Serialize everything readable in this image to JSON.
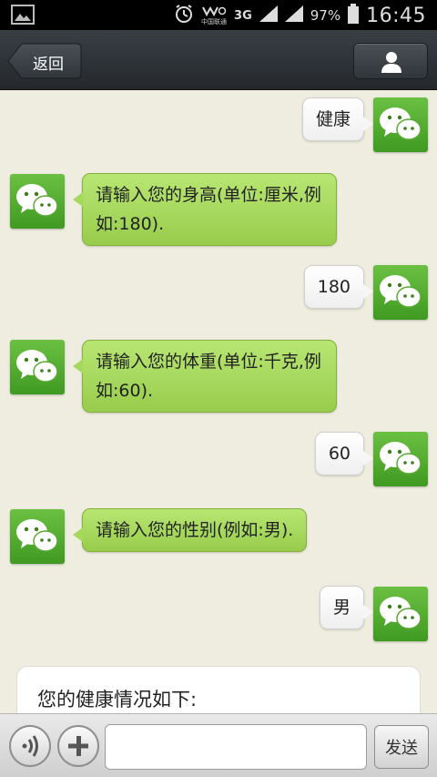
{
  "status_bar": {
    "carrier_line1": "中国联通",
    "network": "3G",
    "battery": "97%",
    "time": "16:45"
  },
  "nav": {
    "back_label": "返回",
    "contact_icon": "person-icon"
  },
  "messages": [
    {
      "side": "out",
      "text": "健康"
    },
    {
      "side": "in",
      "text": "请输入您的身高(单位:厘米,例如:180)."
    },
    {
      "side": "out",
      "text": "180"
    },
    {
      "side": "in",
      "text": "请输入您的体重(单位:千克,例如:60)."
    },
    {
      "side": "out",
      "text": "60"
    },
    {
      "side": "in",
      "text": "请输入您的性别(例如:男)."
    },
    {
      "side": "out",
      "text": "男"
    }
  ],
  "result_card": {
    "text": "您的健康情况如下:"
  },
  "input_bar": {
    "voice_icon": "voice-icon",
    "add_icon": "plus-icon",
    "message_value": "",
    "send_label": "发送"
  },
  "colors": {
    "chat_background": "#efeddf",
    "incoming_bubble": "#a7d85e",
    "outgoing_bubble": "#ffffff",
    "avatar_green": "#4fa82c",
    "nav_background": "#2c3136"
  }
}
